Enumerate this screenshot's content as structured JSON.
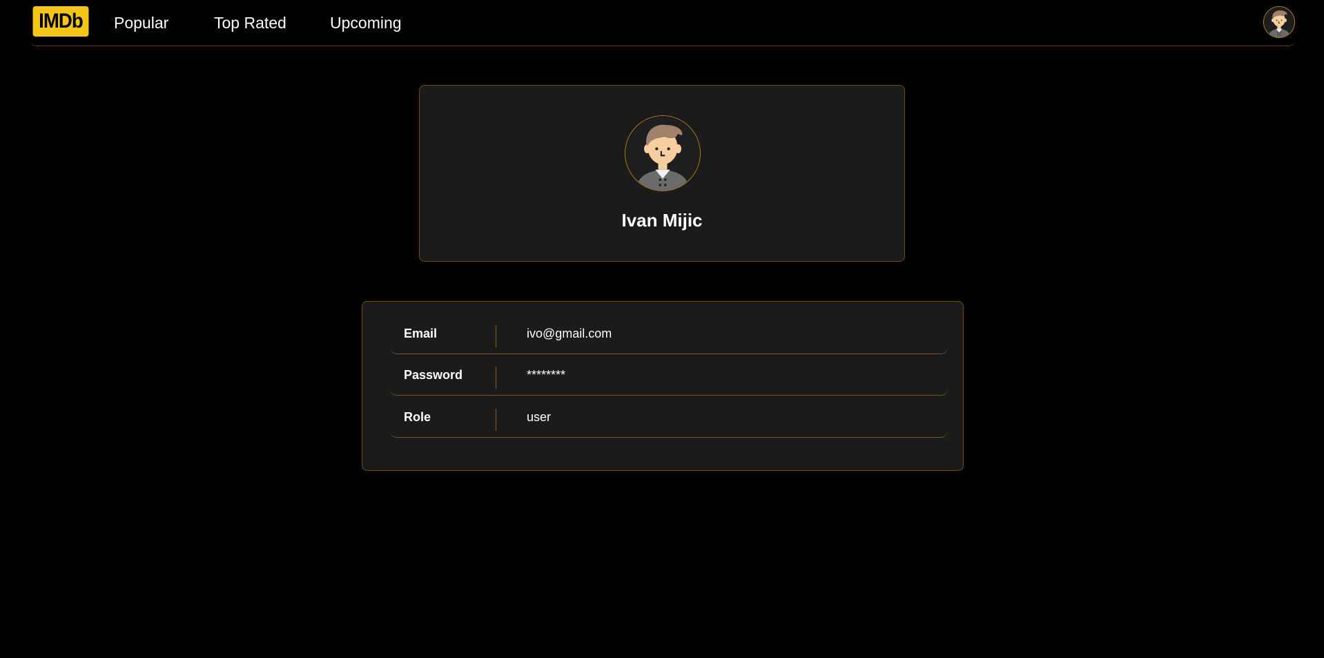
{
  "navbar": {
    "logo_text": "IMDb",
    "links": [
      {
        "label": "Popular"
      },
      {
        "label": "Top Rated"
      },
      {
        "label": "Upcoming"
      }
    ],
    "avatar_icon": "user-avatar-icon"
  },
  "profile": {
    "name": "Ivan Mijic",
    "avatar_icon": "user-avatar-icon"
  },
  "details": {
    "rows": [
      {
        "label": "Email",
        "value": "ivo@gmail.com"
      },
      {
        "label": "Password",
        "value": "********"
      },
      {
        "label": "Role",
        "value": "user"
      }
    ]
  },
  "colors": {
    "brand": "#f5c518",
    "accent_border": "#b57d1a",
    "card_background": "#1b1b1b",
    "page_background": "#000000"
  }
}
